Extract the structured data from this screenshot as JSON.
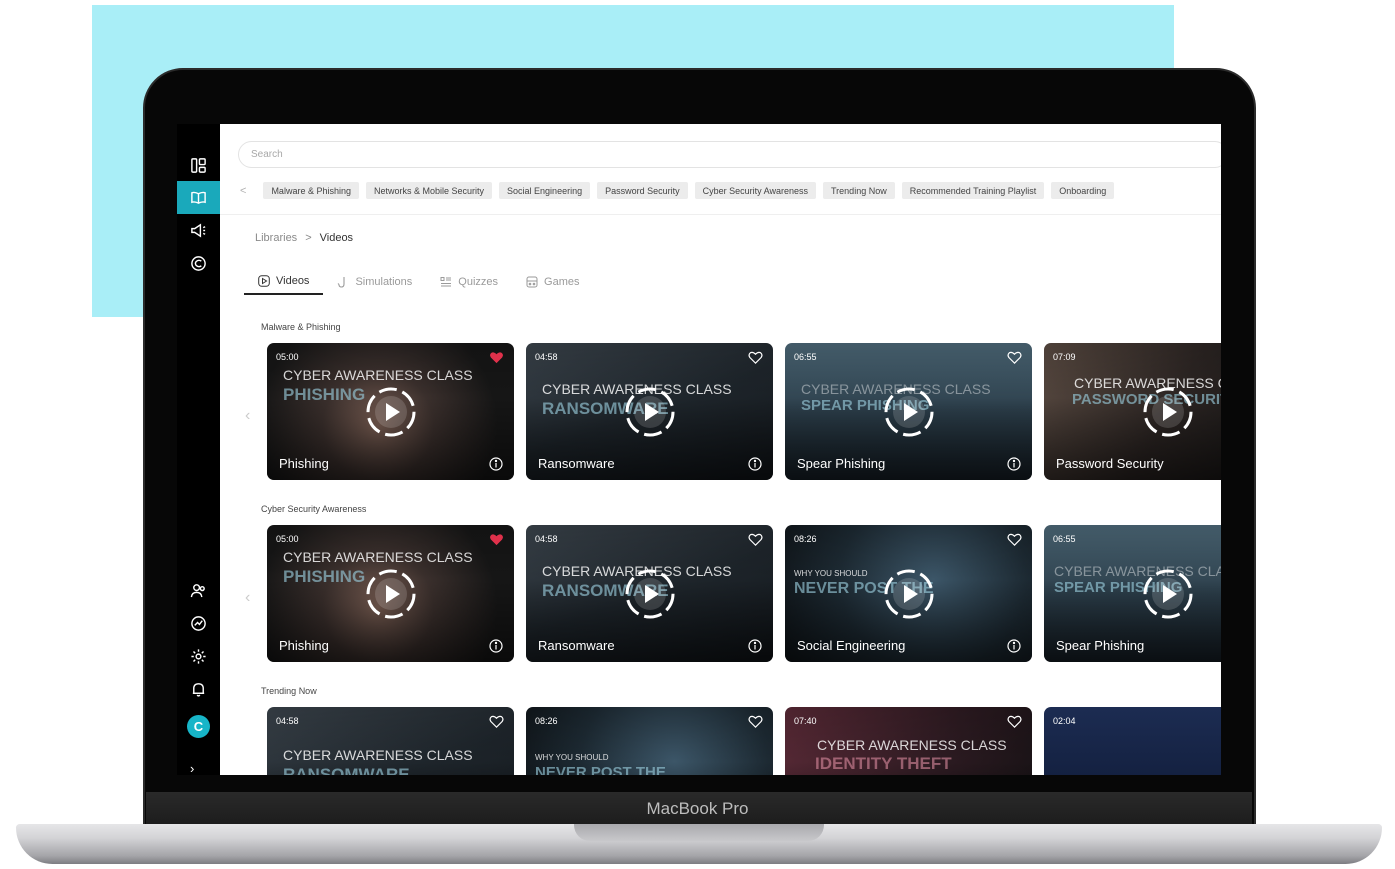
{
  "device": {
    "label": "MacBook Pro"
  },
  "search": {
    "placeholder": "Search"
  },
  "chips": [
    "Malware & Phishing",
    "Networks & Mobile Security",
    "Social Engineering",
    "Password Security",
    "Cyber Security Awareness",
    "Trending Now",
    "Recommended Training Playlist",
    "Onboarding"
  ],
  "breadcrumb": {
    "root": "Libraries",
    "separator": ">",
    "current": "Videos"
  },
  "tabs": [
    {
      "label": "Videos",
      "icon": "play-circle-icon",
      "active": true
    },
    {
      "label": "Simulations",
      "icon": "hook-icon",
      "active": false
    },
    {
      "label": "Quizzes",
      "icon": "list-icon",
      "active": false
    },
    {
      "label": "Games",
      "icon": "gamepad-icon",
      "active": false
    }
  ],
  "sections": [
    {
      "title": "Malware & Phishing",
      "cards": [
        {
          "duration": "05:00",
          "title": "Phishing",
          "overlay": "CYBER AWARENESS CLASS",
          "overlay_sub": "PHISHING",
          "liked": true
        },
        {
          "duration": "04:58",
          "title": "Ransomware",
          "overlay": "CYBER AWARENESS CLASS",
          "overlay_sub": "RANSOMWARE",
          "liked": false
        },
        {
          "duration": "06:55",
          "title": "Spear Phishing",
          "overlay": "CYBER AWARENESS CLASS",
          "overlay_sub": "SPEAR PHISHING",
          "liked": false
        },
        {
          "duration": "07:09",
          "title": "Password Security",
          "overlay": "CYBER AWARENESS CLASS",
          "overlay_sub": "PASSWORD SECURITY",
          "liked": false
        }
      ]
    },
    {
      "title": "Cyber Security Awareness",
      "cards": [
        {
          "duration": "05:00",
          "title": "Phishing",
          "overlay": "CYBER AWARENESS CLASS",
          "overlay_sub": "PHISHING",
          "liked": true
        },
        {
          "duration": "04:58",
          "title": "Ransomware",
          "overlay": "CYBER AWARENESS CLASS",
          "overlay_sub": "RANSOMWARE",
          "liked": false
        },
        {
          "duration": "08:26",
          "title": "Social Engineering",
          "overlay": "WHY YOU SHOULD",
          "overlay_sub": "NEVER POST THE",
          "liked": false
        },
        {
          "duration": "06:55",
          "title": "Spear Phishing",
          "overlay": "CYBER AWARENESS CLASS",
          "overlay_sub": "SPEAR PHISHING",
          "liked": false
        }
      ]
    },
    {
      "title": "Trending Now",
      "cards": [
        {
          "duration": "04:58",
          "title": "",
          "overlay": "CYBER AWARENESS CLASS",
          "overlay_sub": "RANSOMWARE",
          "liked": false
        },
        {
          "duration": "08:26",
          "title": "",
          "overlay": "WHY YOU SHOULD",
          "overlay_sub": "NEVER POST THE",
          "liked": false
        },
        {
          "duration": "07:40",
          "title": "",
          "overlay": "CYBER AWARENESS CLASS",
          "overlay_sub": "IDENTITY THEFT",
          "liked": false
        },
        {
          "duration": "02:04",
          "title": "",
          "overlay": "",
          "overlay_sub": "",
          "liked": false
        }
      ]
    }
  ],
  "sidebar": {
    "top_icons": [
      "dashboard-icon",
      "library-book-icon",
      "megaphone-icon",
      "copyright-icon"
    ],
    "bottom_icons": [
      "users-icon",
      "analytics-icon",
      "settings-gear-icon",
      "bell-icon"
    ],
    "avatar_letter": "C",
    "expand_glyph": "›"
  },
  "colors": {
    "accent": "#1aa9bb",
    "heart_liked": "#e0314b",
    "background_block": "#a9eef7"
  }
}
